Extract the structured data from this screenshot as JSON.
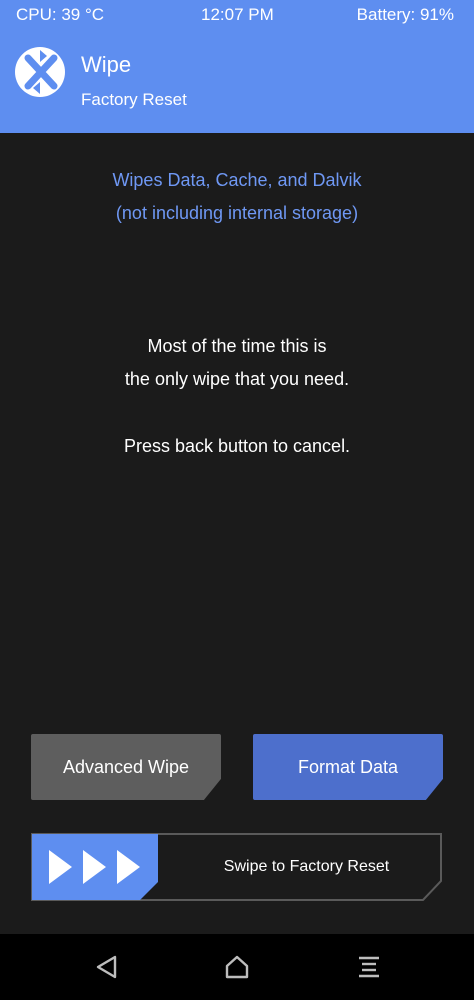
{
  "status_bar": {
    "cpu": "CPU: 39 °C",
    "time": "12:07 PM",
    "battery": "Battery: 91%"
  },
  "header": {
    "title": "Wipe",
    "subtitle": "Factory Reset",
    "logo_icon": "twrp-logo-icon"
  },
  "content": {
    "info_line1": "Wipes Data, Cache, and Dalvik",
    "info_line2": "(not including internal storage)",
    "message_line1": "Most of the time this is",
    "message_line2": "the only wipe that you need.",
    "cancel_hint": "Press back button to cancel."
  },
  "buttons": {
    "advanced_wipe": "Advanced Wipe",
    "format_data": "Format Data"
  },
  "swipe": {
    "label": "Swipe to Factory Reset",
    "handle_icon": "triple-arrow-icon"
  },
  "nav": {
    "back_icon": "back-triangle-icon",
    "home_icon": "home-icon",
    "menu_icon": "menu-lines-icon"
  },
  "colors": {
    "accent": "#5e8ef0",
    "background": "#1b1b1b",
    "info_text": "#6f98f4",
    "button_gray": "#5e5e5e",
    "button_blue": "#4d6fcc"
  }
}
